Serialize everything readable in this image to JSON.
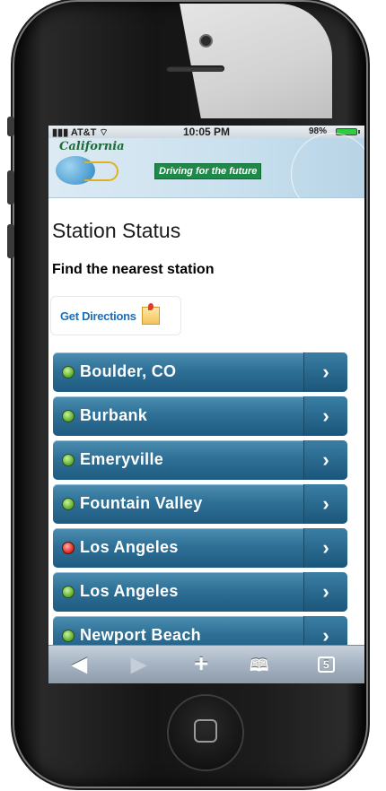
{
  "status_bar": {
    "carrier": "AT&T",
    "time": "10:05 PM",
    "battery": "98%"
  },
  "banner": {
    "logo_text": "California",
    "tagline": "Driving for the future"
  },
  "page": {
    "title": "Station Status",
    "subtitle": "Find the nearest station"
  },
  "directions_button": {
    "label": "Get Directions"
  },
  "stations": [
    {
      "name": "Boulder, CO",
      "status": "green"
    },
    {
      "name": "Burbank",
      "status": "green"
    },
    {
      "name": "Emeryville",
      "status": "green"
    },
    {
      "name": "Fountain Valley",
      "status": "green"
    },
    {
      "name": "Los Angeles",
      "status": "red"
    },
    {
      "name": "Los Angeles",
      "status": "green"
    },
    {
      "name": "Newport Beach",
      "status": "green"
    }
  ],
  "status_colors": {
    "green": "#66b637",
    "red": "#e2342a"
  },
  "toolbar": {
    "back": "◀",
    "forward": "▶",
    "add": "+",
    "bookmarks": "🕮",
    "tabs": "5"
  }
}
